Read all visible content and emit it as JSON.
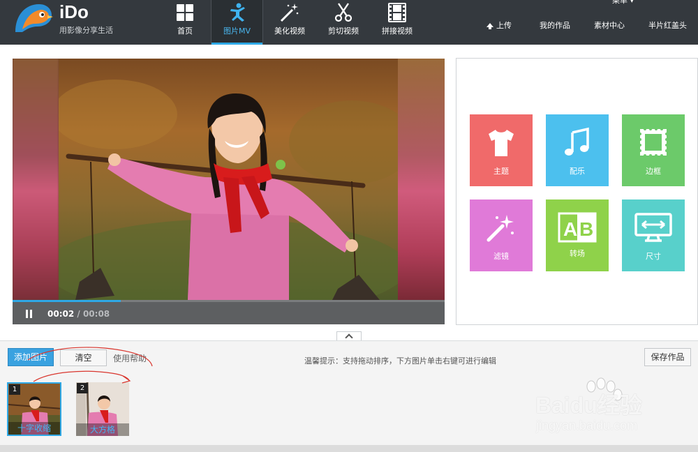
{
  "app": {
    "name": "iDo",
    "slogan": "用影像分享生活",
    "menu_label": "菜单"
  },
  "nav": [
    {
      "label": "首页",
      "icon": "home-grid-icon"
    },
    {
      "label": "图片MV",
      "icon": "dancer-icon",
      "active": true
    },
    {
      "label": "美化视频",
      "icon": "magic-wand-icon"
    },
    {
      "label": "剪切视频",
      "icon": "scissors-icon"
    },
    {
      "label": "拼接视频",
      "icon": "film-strip-icon"
    }
  ],
  "header_links": {
    "upload": "上传",
    "my_works": "我的作品",
    "material": "素材中心",
    "username": "半片红盖头"
  },
  "player": {
    "current_time": "00:02",
    "separator": " / ",
    "duration": "00:08",
    "progress": 0.25
  },
  "tools": [
    {
      "label": "主题",
      "icon": "tshirt-icon",
      "color": "#f06a6a"
    },
    {
      "label": "配乐",
      "icon": "music-note-icon",
      "color": "#4cc0ee"
    },
    {
      "label": "边框",
      "icon": "stamp-frame-icon",
      "color": "#6cca6a"
    },
    {
      "label": "滤镜",
      "icon": "magic-wand-icon",
      "color": "#e07ad8"
    },
    {
      "label": "转场",
      "icon": "ab-transition-icon",
      "color": "#8fd24a"
    },
    {
      "label": "尺寸",
      "icon": "monitor-resize-icon",
      "color": "#58d0cb"
    }
  ],
  "bottom": {
    "add_label": "添加图片",
    "clear_label": "清空",
    "help_label": "使用帮助",
    "tip": "温馨提示：支持拖动排序，下方图片单击右键可进行编辑",
    "save_label": "保存作品"
  },
  "thumbs": [
    {
      "num": "1",
      "name": "十字收缩"
    },
    {
      "num": "2",
      "name": "大方格"
    }
  ],
  "watermark": {
    "text": "Baidu经验",
    "url": "jingyan.baidu.com"
  },
  "colors": {
    "header_bg": "#34393e",
    "accent": "#2ea8e6"
  }
}
